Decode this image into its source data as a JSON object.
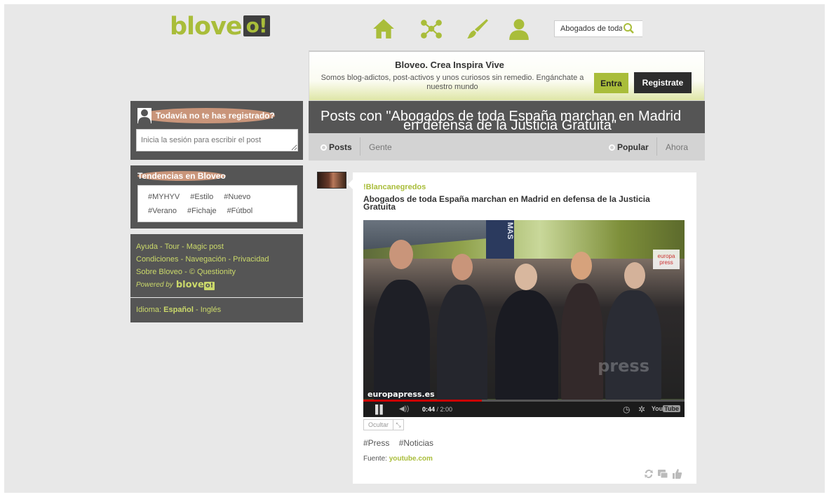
{
  "brand": {
    "name": "blove",
    "mark": "o!"
  },
  "nav": {
    "icons": [
      "home-icon",
      "network-icon",
      "brush-icon",
      "user-icon"
    ]
  },
  "search": {
    "value": "Abogados de toda",
    "icon": "search-icon"
  },
  "banner": {
    "title": "Bloveo. Crea Inspira Vive",
    "description": "Somos blog-adictos, post-activos y unos curiosos sin remedio. Engánchate a nuestro mundo",
    "login_label": "Entra",
    "register_label": "Registrate"
  },
  "sidebar": {
    "register": {
      "heading": "Todavía no te has registrado?",
      "placeholder": "Inicia la sesión para escribir el post"
    },
    "trends": {
      "heading": "Tendencias en Bloveo",
      "row1": [
        "#MYHYV",
        "#Estilo",
        "#Nuevo"
      ],
      "row2": [
        "#Verano",
        "#Fichaje",
        "#Fútbol"
      ]
    },
    "links": {
      "line1": "Ayuda - Tour - Magic post",
      "line2": "Condiciones - Navegación - Privacidad",
      "line3": "Sobre Bloveo - © Questionity",
      "powered_prefix": "Powered by",
      "powered_brand": "blove",
      "powered_mark": "o!"
    },
    "language": {
      "label": "Idioma:",
      "active": "Español",
      "separator": " - ",
      "other": "Inglés"
    }
  },
  "page": {
    "title_line1": "Posts con \"Abogados de toda España marchan en Madrid",
    "title_line2": "en defensa de la Justicia Gratuita\""
  },
  "tabs": {
    "left": [
      {
        "label": "Posts",
        "active": true
      },
      {
        "label": "Gente",
        "active": false
      }
    ],
    "right": [
      {
        "label": "Popular",
        "active": true
      },
      {
        "label": "Ahora",
        "active": false
      }
    ]
  },
  "post": {
    "author": "!Blancanegredos",
    "title": "Abogados de toda España marchan en Madrid en defensa de la Justicia Gratuita",
    "video": {
      "watermark": "europapress.es",
      "banner_text": "MAS",
      "channel_logo_1": "europa",
      "channel_logo_2": "press",
      "overlay": "press",
      "current_time": "0:44",
      "duration": "/ 2:00",
      "progress": 0.37,
      "youtube_label": "You",
      "youtube_tube": "Tube"
    },
    "hide_label": "Ocultar",
    "tags": [
      "#Press",
      "#Noticias"
    ],
    "source_label": "Fuente:",
    "source_value": "youtube.com"
  },
  "colors": {
    "accent": "#a9bd3a",
    "dark": "#555555",
    "background": "#e8e8e8"
  }
}
